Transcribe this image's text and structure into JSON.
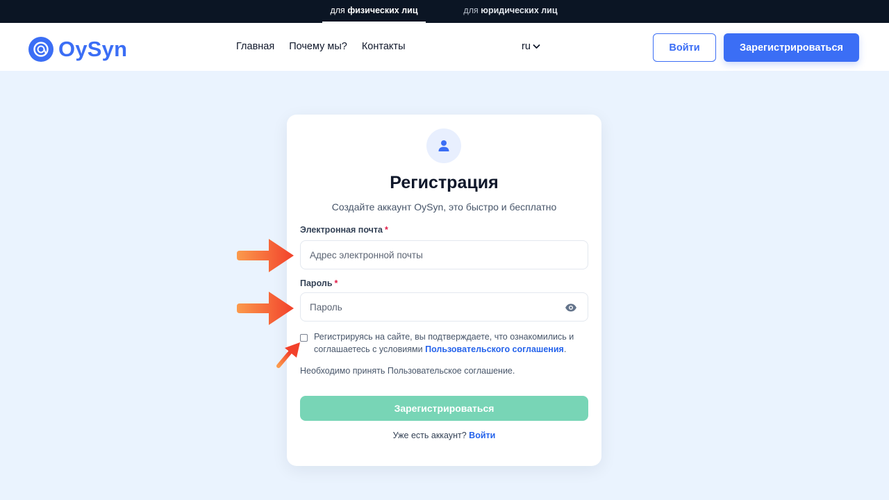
{
  "top_segment": {
    "individuals": {
      "prefix": "для",
      "bold": "физических лиц"
    },
    "legal": {
      "prefix": "для",
      "bold": "юридических лиц"
    }
  },
  "brand": {
    "name": "OySyn",
    "color": "#3b6ef5"
  },
  "nav": {
    "items": [
      "Главная",
      "Почему мы?",
      "Контакты"
    ],
    "language": "ru"
  },
  "header_actions": {
    "login": "Войти",
    "register": "Зарегистрироваться"
  },
  "form": {
    "title": "Регистрация",
    "subtitle": "Создайте аккаунт OySyn, это быстро и бесплатно",
    "email": {
      "label": "Электронная почта",
      "required_mark": "*",
      "placeholder": "Адрес электронной почты",
      "value": ""
    },
    "password": {
      "label": "Пароль",
      "required_mark": "*",
      "placeholder": "Пароль",
      "value": "",
      "toggle_icon": "eye-icon"
    },
    "consent": {
      "checked": false,
      "text_before": "Регистрируясь на сайте, вы подтверждаете, что ознакомились и соглашаетесь с условиями ",
      "link": "Пользовательского соглашения",
      "text_after": "."
    },
    "error": "Необходимо принять Пользовательское соглашение.",
    "submit": "Зарегистрироваться",
    "have_account": "Уже есть аккаунт?",
    "login_link": "Войти"
  },
  "colors": {
    "page_bg": "#eaf3fe",
    "topbar_bg": "#0b1524",
    "accent": "#3b6ef5",
    "submit_disabled": "#78d5b6",
    "annotation_arrow": "#fb6a3c"
  }
}
